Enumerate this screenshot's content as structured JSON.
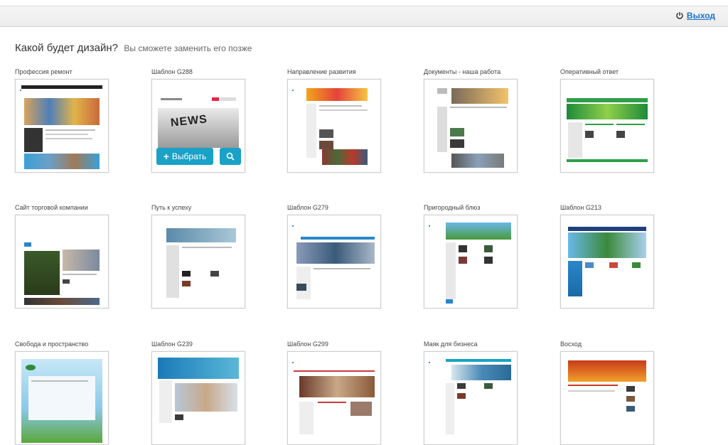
{
  "header": {
    "logout_label": "Выход"
  },
  "page": {
    "title": "Какой будет дизайн?",
    "subtitle": "Вы сможете заменить его позже"
  },
  "templates": [
    {
      "label": "Профессия ремонт"
    },
    {
      "label": "Шаблон G288"
    },
    {
      "label": "Направление развития"
    },
    {
      "label": "Документы - наша работа"
    },
    {
      "label": "Оперативный ответ"
    },
    {
      "label": "Сайт торговой компании"
    },
    {
      "label": "Путь к успеху"
    },
    {
      "label": "Шаблон G279"
    },
    {
      "label": "Пригородный блюз"
    },
    {
      "label": "Шаблон G213"
    },
    {
      "label": "Свобода и пространство"
    },
    {
      "label": "Шаблон G239"
    },
    {
      "label": "Шаблон G299"
    },
    {
      "label": "Маяк для бизнеса"
    },
    {
      "label": "Восход"
    }
  ],
  "hover_actions": {
    "select_label": "Выбрать"
  },
  "thumb_news_text": "NEWS",
  "colors": {
    "accent": "#1aa1c7",
    "link": "#1a73c8"
  }
}
